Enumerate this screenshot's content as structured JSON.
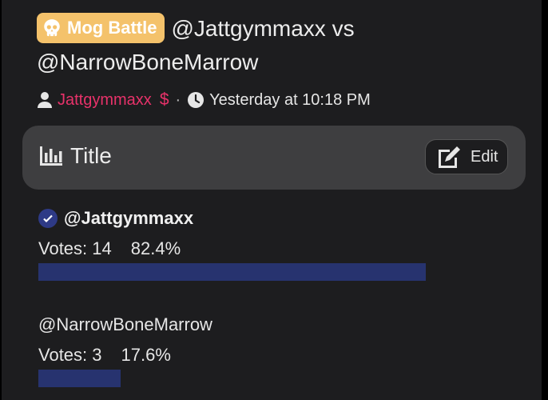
{
  "post": {
    "badge_label": "Mog Battle",
    "title_part1": "@Jattgymmaxx vs",
    "title_part2": "@NarrowBoneMarrow",
    "author": "Jattgymmaxx",
    "author_badge": "$",
    "separator": "·",
    "timestamp": "Yesterday at 10:18 PM"
  },
  "poll": {
    "title": "Title",
    "edit_label": "Edit",
    "options": [
      {
        "name": "@Jattgymmaxx",
        "votes_text": "Votes: 14",
        "percent_text": "82.4%",
        "percent": 82.4,
        "selected": true
      },
      {
        "name": "@NarrowBoneMarrow",
        "votes_text": "Votes: 3",
        "percent_text": "17.6%",
        "percent": 17.6,
        "selected": false
      }
    ]
  },
  "colors": {
    "badge_bg": "#f4c26b",
    "author": "#e8326a",
    "bar": "#27336f",
    "check": "#2e3a86"
  },
  "icons": [
    "skull-icon",
    "user-icon",
    "dollar-icon",
    "clock-icon",
    "bar-chart-icon",
    "edit-icon",
    "check-circle-icon"
  ]
}
